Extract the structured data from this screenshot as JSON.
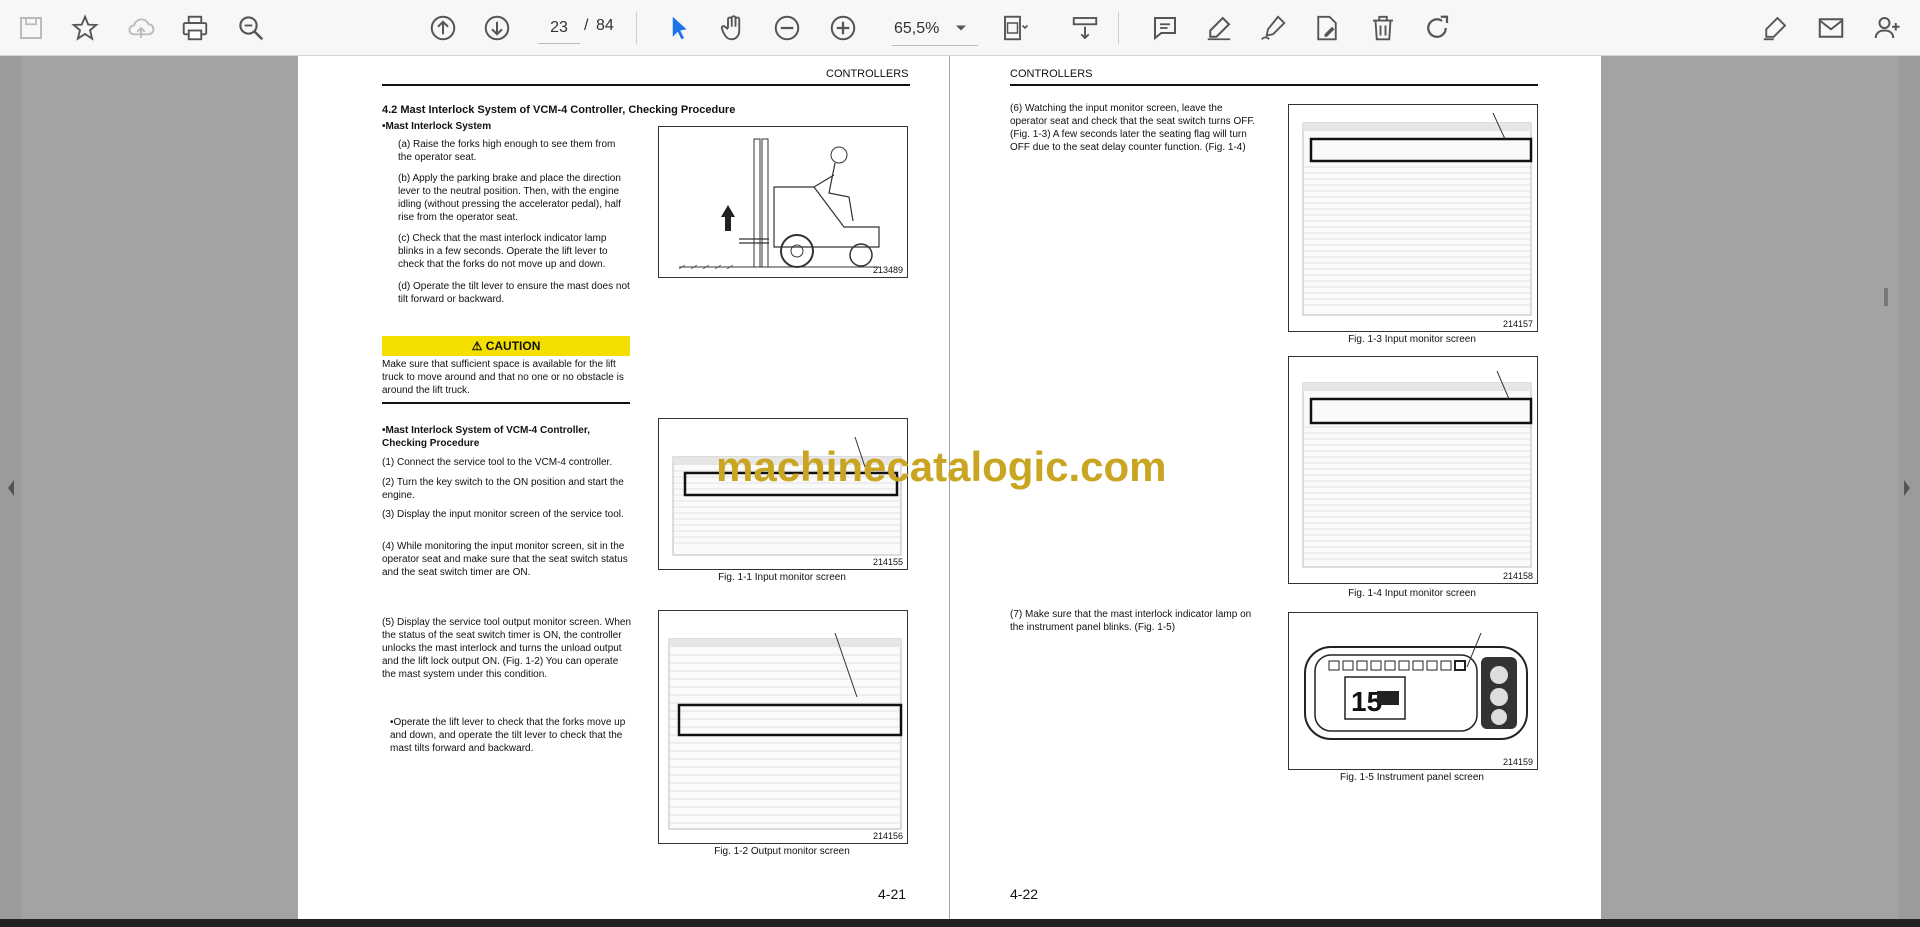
{
  "toolbar": {
    "page_current": "23",
    "page_separator": "/",
    "page_total": "84",
    "zoom": "65,5%"
  },
  "left_page": {
    "header": "CONTROLLERS",
    "section_title": "4.2   Mast Interlock System of VCM-4 Controller, Checking Procedure",
    "subhead": "•Mast Interlock System",
    "items": [
      "(a) Raise the forks high enough to see them from the operator seat.",
      "(b) Apply the parking brake and place the direction lever to the neutral position. Then, with the engine idling (without pressing the accelerator pedal), half rise from the operator seat.",
      "(c) Check that the mast interlock indicator lamp blinks in a few seconds. Operate the lift lever to check that the forks do not move up and down.",
      "(d) Operate the tilt lever to ensure the mast does not tilt forward or backward."
    ],
    "caution_label": "CAUTION",
    "caution_text": "Make sure that sufficient space is available for the lift truck to move around and that no one or no obstacle is around the lift truck.",
    "subhead2": "•Mast Interlock System of VCM-4 Controller, Checking Procedure",
    "steps": [
      "(1)  Connect the service tool to the VCM-4 controller.",
      "(2)  Turn the key switch to the ON position and start the engine.",
      "(3)  Display the input monitor screen of the service tool.",
      "(4)  While monitoring the input monitor screen, sit in the operator seat and make sure that the seat switch status and the seat switch timer are ON.",
      "(5)  Display the service tool output monitor screen. When the status of the seat switch timer is ON, the controller unlocks the mast interlock and turns the unload output and the lift lock output ON. (Fig. 1-2) You can operate the mast system under this condition.",
      "•Operate the lift lever to check that the forks move up and down, and operate the tilt lever to check that the mast tilts forward and backward."
    ],
    "fig_top_no": "213489",
    "fig1_no": "214155",
    "fig1_cap": "Fig. 1-1 Input monitor screen",
    "fig2_no": "214156",
    "fig2_cap": "Fig. 1-2 Output monitor screen",
    "page_number": "4-21"
  },
  "right_page": {
    "header": "CONTROLLERS",
    "step6": "(6)  Watching the input monitor screen, leave the operator seat and check that the seat switch turns OFF. (Fig. 1-3) A few seconds later the seating flag will turn OFF due to the seat delay counter function. (Fig. 1-4)",
    "step7": "(7)  Make sure that the mast interlock indicator lamp on the instrument panel blinks. (Fig. 1-5)",
    "fig3_no": "214157",
    "fig3_cap": "Fig. 1-3 Input monitor screen",
    "fig4_no": "214158",
    "fig4_cap": "Fig. 1-4 Input monitor screen",
    "fig5_no": "214159",
    "fig5_cap": "Fig. 1-5 Instrument panel screen",
    "page_number": "4-22"
  },
  "watermark": "machinecatalogic.com"
}
